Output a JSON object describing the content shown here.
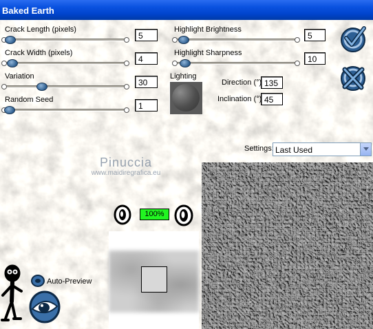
{
  "window": {
    "title": "Baked Earth"
  },
  "parameters": {
    "crack_length": {
      "label": "Crack Length (pixels)",
      "value": "5",
      "level": 0.03
    },
    "crack_width": {
      "label": "Crack Width (pixels)",
      "value": "4",
      "level": 0.05
    },
    "variation": {
      "label": "Variation",
      "value": "30",
      "level": 0.3
    },
    "random_seed": {
      "label": "Random Seed",
      "value": "1",
      "level": 0.0
    },
    "highlight_brightness": {
      "label": "Highlight Brightness",
      "value": "5",
      "level": 0.05
    },
    "highlight_sharpness": {
      "label": "Highlight Sharpness",
      "value": "10",
      "level": 0.1
    }
  },
  "lighting": {
    "label": "Lighting",
    "direction_label": "Direction (°)",
    "direction_value": "135",
    "inclination_label": "Inclination (°)",
    "inclination_value": "45"
  },
  "settings": {
    "label": "Settings:",
    "value": "Last Used"
  },
  "watermark": {
    "name": "Pinuccia",
    "url": "www.maidiregrafica.eu"
  },
  "preview": {
    "zoom": "100%",
    "auto_preview_label": "Auto-Preview"
  },
  "icons": {
    "ok": "checkmark-icon",
    "cancel": "x-icon",
    "zoom_out": "zoom-out-icon",
    "zoom_in": "zoom-in-icon",
    "help": "help-figure-icon",
    "auto_preview": "toggle-eye-icon",
    "proof": "eye-icon"
  },
  "colors": {
    "title_bar": "#0a52e0",
    "zoom_indicator": "#21f521",
    "icon_blue": "#3a6fa8"
  }
}
